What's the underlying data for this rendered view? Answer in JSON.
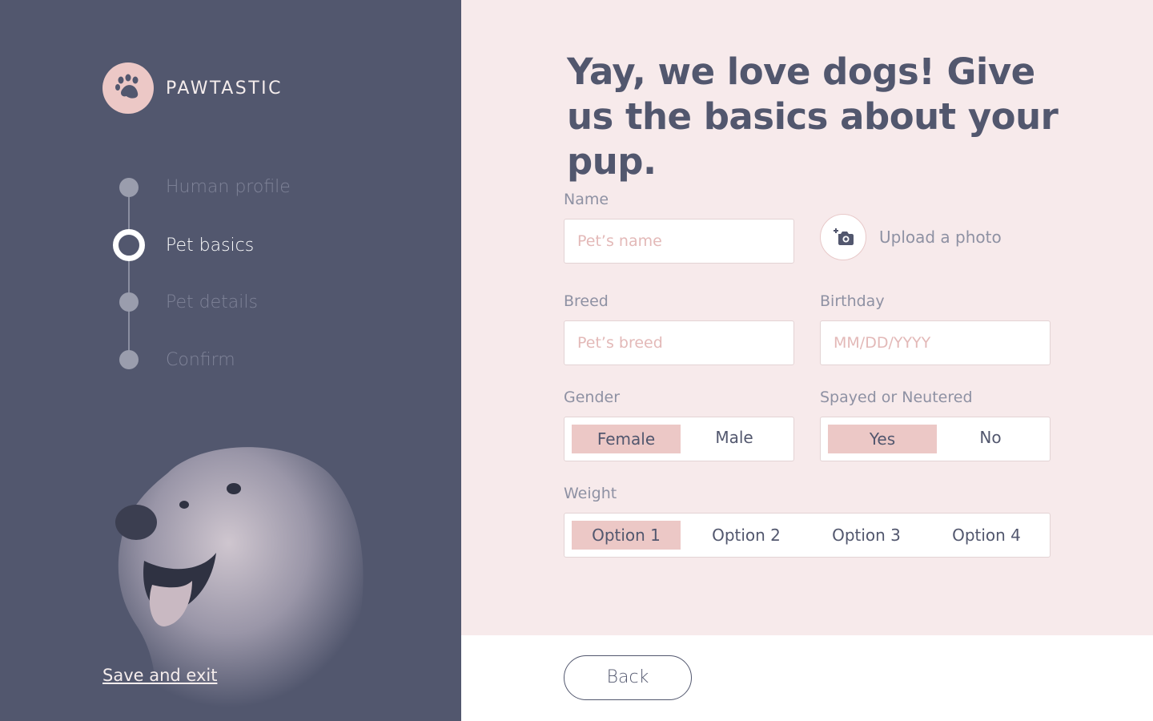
{
  "brand": {
    "name": "PAWTASTIC",
    "logo_icon": "paw-icon"
  },
  "steps": [
    {
      "label": "Human profile",
      "state": "inactive"
    },
    {
      "label": "Pet basics",
      "state": "active"
    },
    {
      "label": "Pet details",
      "state": "inactive"
    },
    {
      "label": "Confirm",
      "state": "inactive"
    }
  ],
  "sidebar": {
    "save_exit": "Save and exit"
  },
  "main": {
    "heading": "Yay, we love dogs! Give us the basics about your pup.",
    "name": {
      "label": "Name",
      "placeholder": "Pet’s name"
    },
    "upload": {
      "label": "Upload a photo",
      "icon": "camera-add-icon"
    },
    "breed": {
      "label": "Breed",
      "placeholder": "Pet’s breed"
    },
    "birthday": {
      "label": "Birthday",
      "placeholder": "MM/DD/YYYY"
    },
    "gender": {
      "label": "Gender",
      "options": [
        "Female",
        "Male"
      ],
      "selected": "Female"
    },
    "spayed": {
      "label": "Spayed or Neutered",
      "options": [
        "Yes",
        "No"
      ],
      "selected": "Yes"
    },
    "weight": {
      "label": "Weight",
      "options": [
        "Option 1",
        "Option 2",
        "Option 3",
        "Option 4"
      ],
      "selected": "Option 1"
    }
  },
  "footer": {
    "back": "Back"
  },
  "colors": {
    "sidebar": "#52576e",
    "main_bg": "#f7eaeb",
    "accent": "#ecc8c6",
    "text_dark": "#52576e"
  }
}
